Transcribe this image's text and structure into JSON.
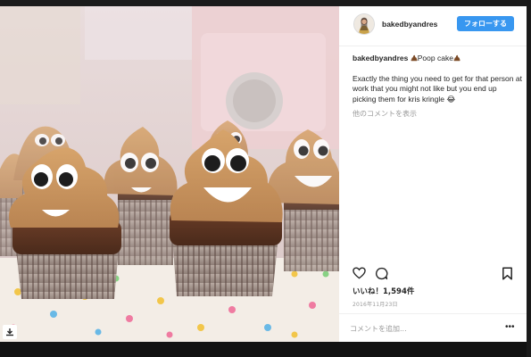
{
  "post": {
    "username": "bakedbyandres",
    "follow_label": "フォローする",
    "caption_user": "bakedbyandres",
    "caption_emoji": "poop-emoji",
    "caption_text": "Poop cake",
    "caption_end_emoji": "poop-emoji",
    "comment_text": "Exactly the thing you need to get for that person at work that you might not like but you end up picking them for kris kringle",
    "comment_emoji": "😂",
    "more_comments_label": "他のコメントを表示",
    "likes_label": "いいね！1,594件",
    "date": "2016年11月23日",
    "comment_placeholder": "コメントを追加...",
    "more_options_label": "•••"
  },
  "icons": {
    "like": "heart-icon",
    "comment": "comment-icon",
    "save": "bookmark-icon",
    "download": "download-icon"
  },
  "colors": {
    "follow_button": "#3897f0",
    "text": "#262626",
    "muted": "#999999",
    "frosting": "#c9935c",
    "cake": "#5a3422"
  }
}
